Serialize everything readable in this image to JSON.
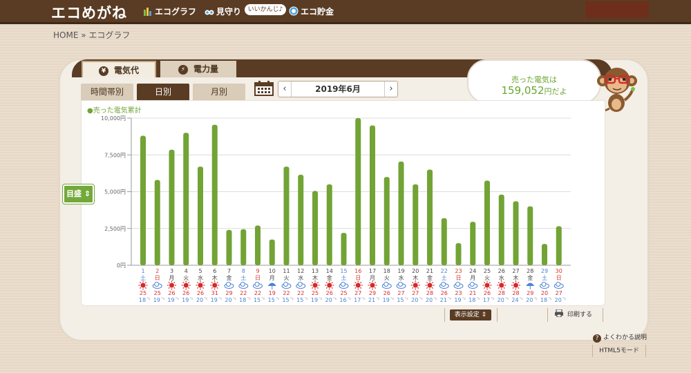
{
  "header": {
    "logo": "エコめがね",
    "nav": [
      {
        "label": "エコグラフ",
        "icon": "bar-chart-icon"
      },
      {
        "label": "見守り",
        "icon": "binoculars-icon"
      },
      {
        "label": "エコ貯金",
        "icon": "coin-icon"
      }
    ],
    "bubble": "いいかんじ♪"
  },
  "breadcrumb": "HOME » エコグラフ",
  "tabs": {
    "cost": {
      "label": "電気代",
      "icon": "¥"
    },
    "power": {
      "label": "電力量",
      "icon": "⚡"
    }
  },
  "subtabs": [
    "時間帯別",
    "日別",
    "月別"
  ],
  "date": {
    "label": "2019年6月",
    "prev": "‹",
    "next": "›"
  },
  "sold": {
    "label": "売った電気は",
    "value": "159,052",
    "unit": "円だよ"
  },
  "scale_button": "目盛 ⇕",
  "footer": {
    "display_settings": "表示設定 ⇕",
    "print": "印刷する",
    "help": "よくわかる説明",
    "html5": "HTML5モード"
  },
  "colors": {
    "bar": "#72a335",
    "legend_text": "#72a335",
    "saturday": "#4a82d4",
    "sunday": "#d43a2a",
    "weekday": "#444444",
    "brown": "#5a3c24"
  },
  "chart_data": {
    "type": "bar",
    "legend": "●売った電気累計",
    "y_ticks": [
      "0円",
      "2,500円",
      "5,000円",
      "7,500円",
      "10,000円"
    ],
    "ylim": [
      0,
      10000
    ],
    "days": [
      "1",
      "2",
      "3",
      "4",
      "5",
      "6",
      "7",
      "8",
      "9",
      "10",
      "11",
      "12",
      "13",
      "14",
      "15",
      "16",
      "17",
      "18",
      "19",
      "20",
      "21",
      "22",
      "23",
      "24",
      "25",
      "26",
      "27",
      "28",
      "29",
      "30"
    ],
    "weekdays": [
      "土",
      "日",
      "月",
      "火",
      "水",
      "木",
      "金",
      "土",
      "日",
      "月",
      "火",
      "水",
      "木",
      "金",
      "土",
      "日",
      "月",
      "火",
      "水",
      "木",
      "金",
      "土",
      "日",
      "月",
      "火",
      "水",
      "木",
      "金",
      "土",
      "日"
    ],
    "values": [
      8800,
      5800,
      7850,
      9000,
      6700,
      9550,
      2400,
      2450,
      2700,
      1750,
      6700,
      6150,
      5050,
      5500,
      2200,
      10000,
      9500,
      6000,
      7050,
      5500,
      6500,
      3200,
      1500,
      2950,
      5750,
      4800,
      4350,
      4000,
      1450,
      2650
    ],
    "weather": [
      "sun",
      "cloud",
      "sun",
      "sun",
      "sun",
      "sun",
      "cloud",
      "cloud",
      "cloud",
      "rain",
      "cloud",
      "cloud",
      "sun",
      "sun",
      "cloud",
      "sun",
      "sun",
      "cloud",
      "cloud",
      "sun",
      "sun",
      "cloud",
      "cloud",
      "cloud",
      "sun",
      "sun",
      "sun",
      "rain",
      "cloud",
      "cloud"
    ],
    "temp_high": [
      "25",
      "25",
      "26",
      "26",
      "26",
      "31",
      "29",
      "22",
      "22",
      "19",
      "22",
      "22",
      "25",
      "26",
      "25",
      "27",
      "29",
      "26",
      "27",
      "27",
      "28",
      "26",
      "23",
      "21",
      "26",
      "28",
      "28",
      "29",
      "20",
      "27"
    ],
    "temp_low": [
      "18",
      "19",
      "19",
      "19",
      "20",
      "19",
      "20",
      "18",
      "15",
      "15",
      "15",
      "15",
      "19",
      "20",
      "16",
      "17",
      "21",
      "19",
      "15",
      "20",
      "20",
      "21",
      "19",
      "18",
      "17",
      "20",
      "24",
      "20",
      "18",
      "20"
    ],
    "temp_unit": "°c"
  }
}
